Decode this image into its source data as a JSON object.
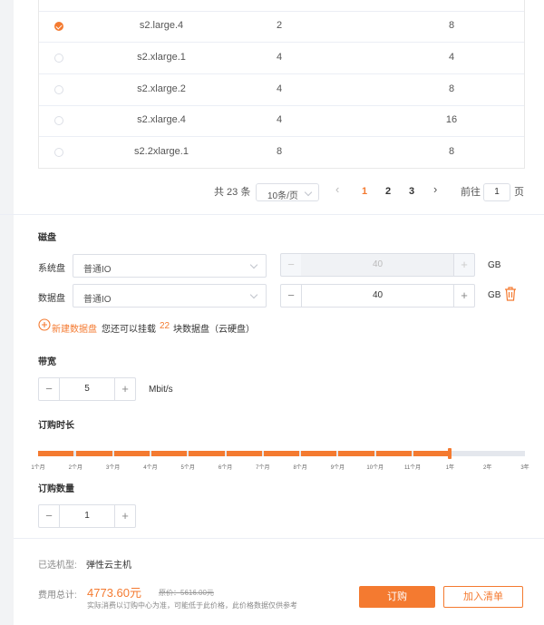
{
  "table": {
    "rows": [
      {
        "selected": true,
        "name": "s2.large.4",
        "cpu": "2",
        "mem": "8"
      },
      {
        "selected": false,
        "name": "s2.xlarge.1",
        "cpu": "4",
        "mem": "4"
      },
      {
        "selected": false,
        "name": "s2.xlarge.2",
        "cpu": "4",
        "mem": "8"
      },
      {
        "selected": false,
        "name": "s2.xlarge.4",
        "cpu": "4",
        "mem": "16"
      },
      {
        "selected": false,
        "name": "s2.2xlarge.1",
        "cpu": "8",
        "mem": "8"
      }
    ]
  },
  "pagination": {
    "total": "共 23 条",
    "page_size": "10条/页",
    "prev": "‹",
    "pages": [
      "1",
      "2",
      "3"
    ],
    "current": "1",
    "next": "›",
    "goto_label": "前往",
    "goto_value": "1",
    "goto_suffix": "页"
  },
  "disk": {
    "title": "磁盘",
    "system_label": "系统盘",
    "system_type": "普通IO",
    "system_size": "40",
    "data_label": "数据盘",
    "data_type": "普通IO",
    "data_size": "40",
    "unit": "GB",
    "add_label": "新建数据盘",
    "hint_prefix": "您还可以挂载",
    "hint_count": "22",
    "hint_suffix": "块数据盘（云硬盘）"
  },
  "bandwidth": {
    "title": "带宽",
    "value": "5",
    "unit": "Mbit/s"
  },
  "duration": {
    "title": "订购时长",
    "ticks": [
      "1个月",
      "2个月",
      "3个月",
      "4个月",
      "5个月",
      "6个月",
      "7个月",
      "8个月",
      "9个月",
      "10个月",
      "11个月",
      "1年",
      "2年",
      "3年"
    ],
    "selected": "1年"
  },
  "quantity": {
    "title": "订购数量",
    "value": "1"
  },
  "footer": {
    "model_label": "已选机型:",
    "model_value": "弹性云主机",
    "cost_label": "费用总计:",
    "cost_value": "4773.60元",
    "original_price": "原价：5616.00元",
    "note": "实际消费以订购中心为准，可能低于此价格，此价格数据仅供参考",
    "order_button": "订购",
    "cart_button": "加入清单"
  },
  "colors": {
    "accent": "#f47a30"
  }
}
